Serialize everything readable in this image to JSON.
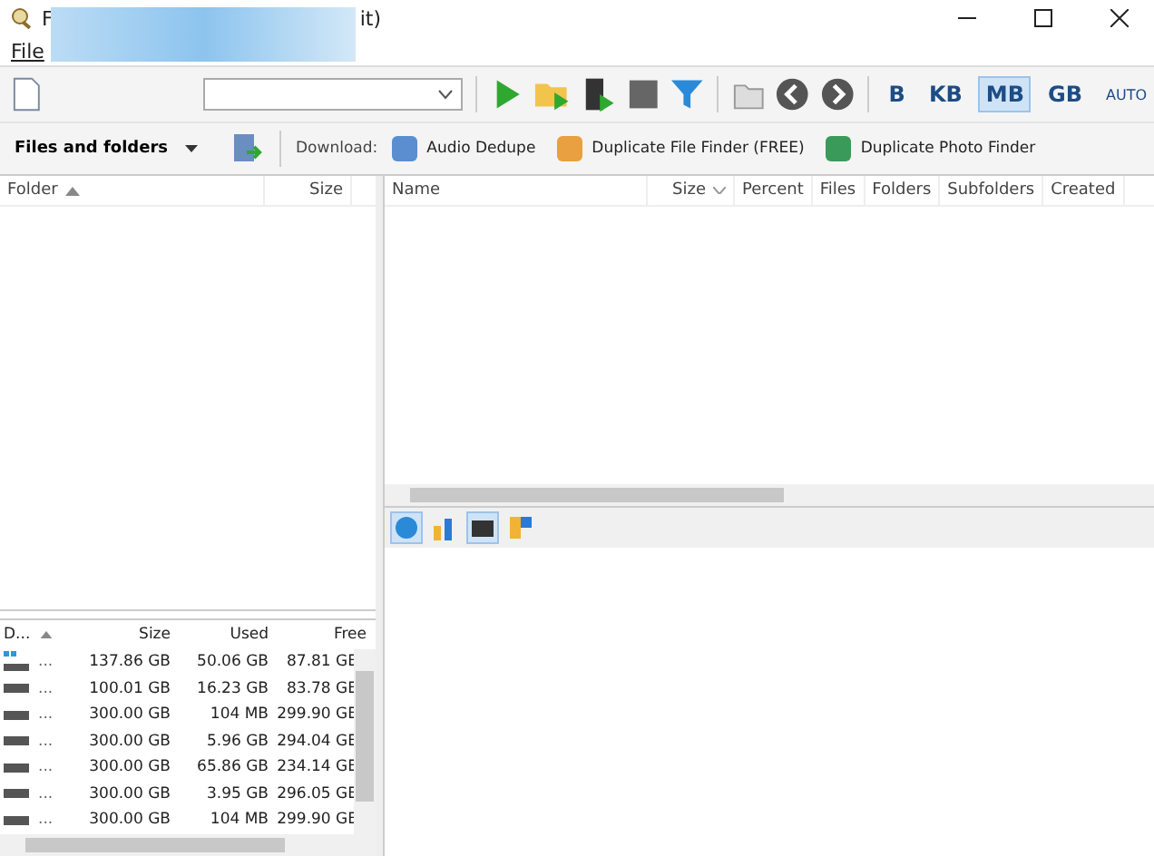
{
  "window": {
    "title_start": "F",
    "title_end": "it)"
  },
  "menu": [
    "File"
  ],
  "units": [
    {
      "label": "B",
      "selected": false
    },
    {
      "label": "KB",
      "selected": false
    },
    {
      "label": "MB",
      "selected": true
    },
    {
      "label": "GB",
      "selected": false
    },
    {
      "label": "AUTO",
      "selected": false
    }
  ],
  "view_selector": {
    "label": "Files and folders"
  },
  "download": {
    "label": "Download:",
    "links": [
      "Audio Dedupe",
      "Duplicate File Finder (FREE)",
      "Duplicate Photo Finder"
    ]
  },
  "folder_columns": [
    "Folder",
    "Size"
  ],
  "file_columns": [
    "Name",
    "Size",
    "Percent",
    "Files",
    "Folders",
    "Subfolders",
    "Created"
  ],
  "chart_tabs": [
    {
      "selected": true
    },
    {
      "selected": false
    },
    {
      "selected": true
    },
    {
      "selected": false
    }
  ],
  "drives": {
    "columns": [
      "D...",
      "Size",
      "Used",
      "Free"
    ],
    "rows": [
      {
        "kind": "system",
        "name": "...",
        "size": "137.86 GB",
        "used": "50.06 GB",
        "free": "87.81 GE"
      },
      {
        "kind": "disk",
        "name": "...",
        "size": "100.01 GB",
        "used": "16.23 GB",
        "free": "83.78 GE"
      },
      {
        "kind": "disk",
        "name": "...",
        "size": "300.00 GB",
        "used": "104 MB",
        "free": "299.90 GE"
      },
      {
        "kind": "disk",
        "name": "...",
        "size": "300.00 GB",
        "used": "5.96 GB",
        "free": "294.04 GE"
      },
      {
        "kind": "disk",
        "name": "...",
        "size": "300.00 GB",
        "used": "65.86 GB",
        "free": "234.14 GE"
      },
      {
        "kind": "disk",
        "name": "...",
        "size": "300.00 GB",
        "used": "3.95 GB",
        "free": "296.05 GE"
      },
      {
        "kind": "disk",
        "name": "...",
        "size": "300.00 GB",
        "used": "104 MB",
        "free": "299.90 GE"
      }
    ]
  }
}
